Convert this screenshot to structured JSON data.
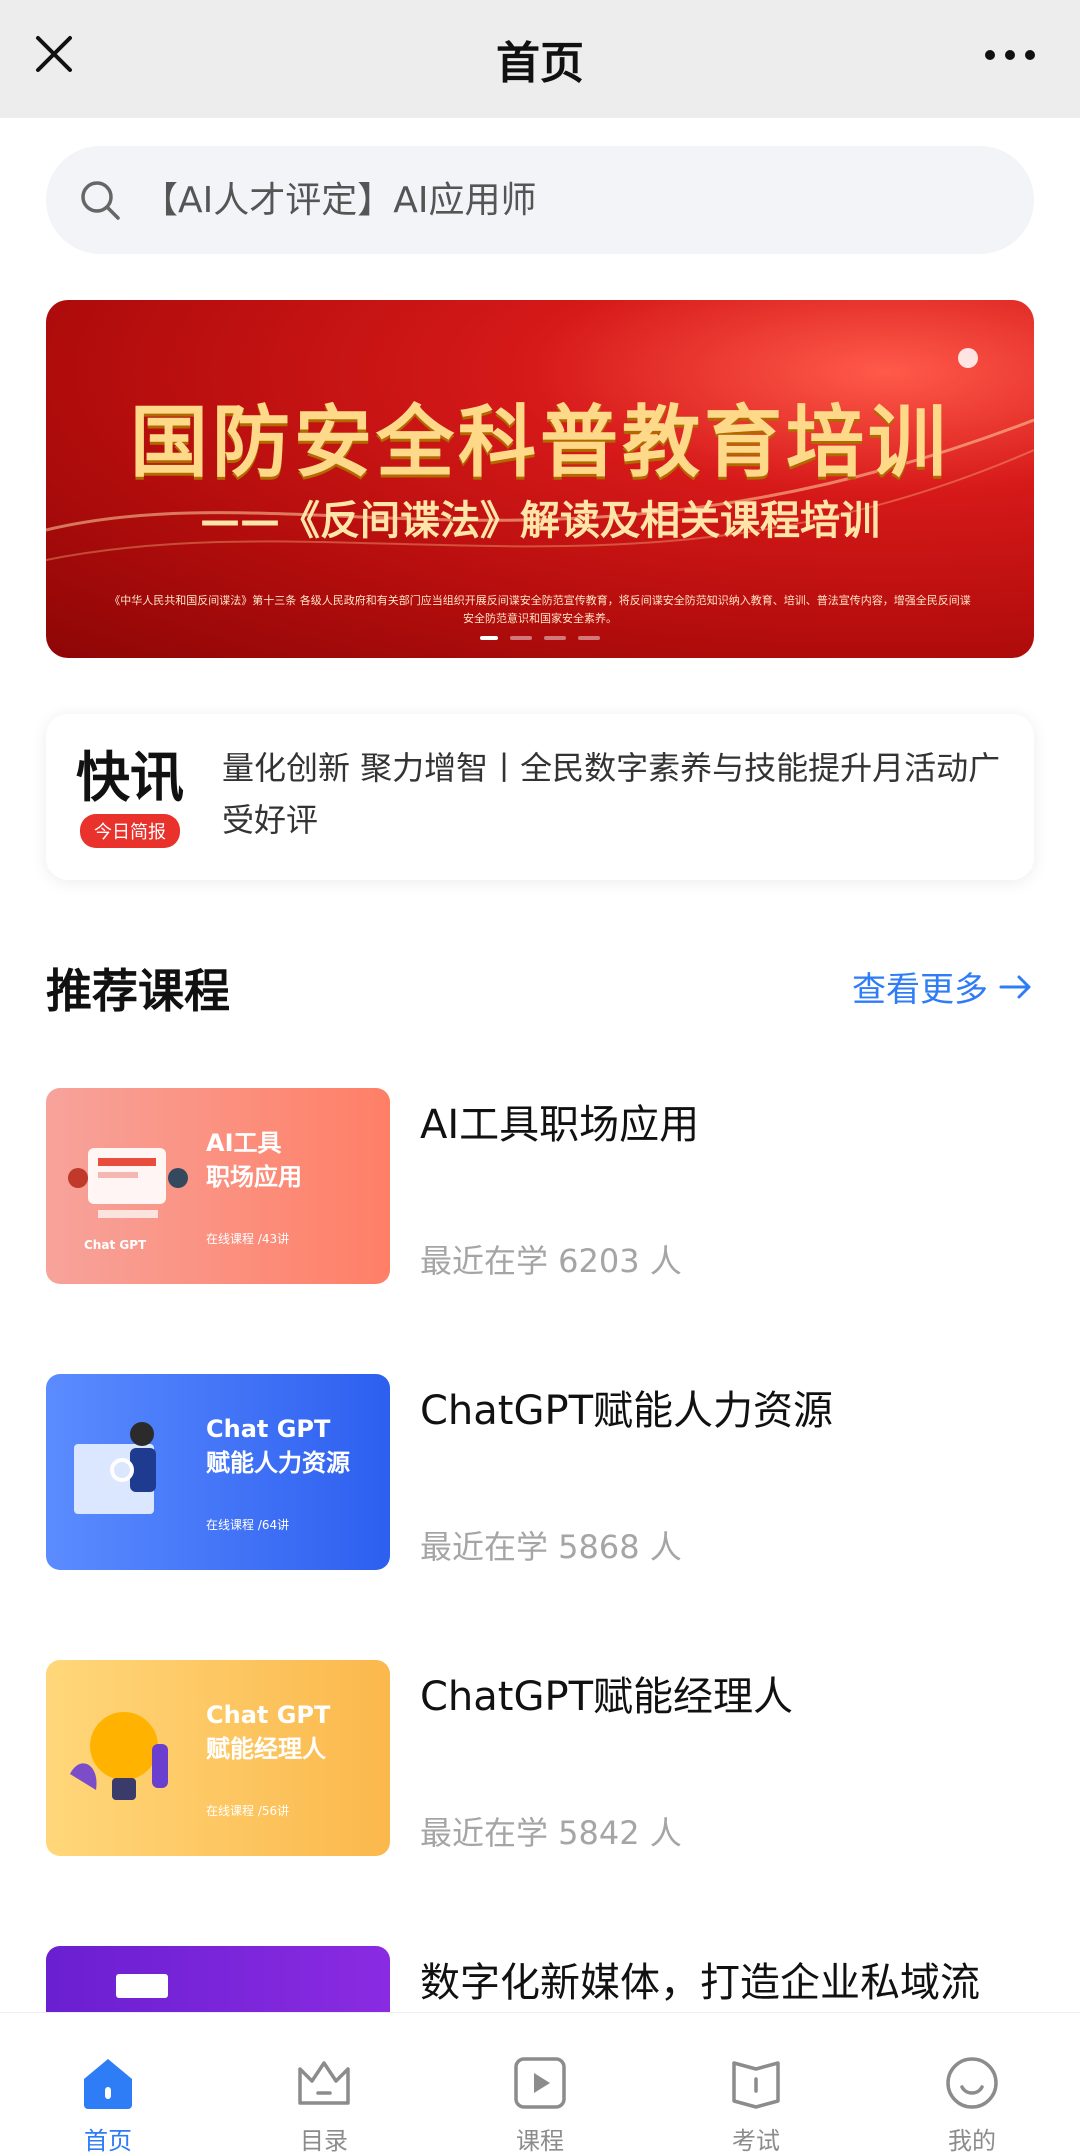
{
  "header": {
    "title": "首页"
  },
  "search": {
    "placeholder": "【AI人才评定】AI应用师"
  },
  "banner": {
    "title": "国防安全科普教育培训",
    "subtitle": "——《反间谍法》解读及相关课程培训",
    "small_text": "《中华人民共和国反间谍法》第十三条 各级人民政府和有关部门应当组织开展反间谍安全防范宣传教育，将反间谍安全防范知识纳入教育、培训、普法宣传内容，增强全民反间谍安全防范意识和国家安全素养。"
  },
  "news": {
    "brand": "快讯",
    "tag": "今日简报",
    "text": "量化创新 聚力增智丨全民数字素养与技能提升月活动广受好评"
  },
  "recommend": {
    "title": "推荐课程",
    "see_more": "查看更多"
  },
  "courses": [
    {
      "name": "AI工具职场应用",
      "thumb_title_1": "AI工具",
      "thumb_title_2": "职场应用",
      "thumb_badge": "Chat GPT",
      "thumb_lessons": "在线课程 /43讲",
      "meta": "最近在学 6203 人"
    },
    {
      "name": "ChatGPT赋能人力资源",
      "thumb_title_1": "Chat GPT",
      "thumb_title_2": "赋能人力资源",
      "thumb_lessons": "在线课程 /64讲",
      "meta": "最近在学 5868 人"
    },
    {
      "name": "ChatGPT赋能经理人",
      "thumb_title_1": "Chat GPT",
      "thumb_title_2": "赋能经理人",
      "thumb_lessons": "在线课程 /56讲",
      "meta": "最近在学 5842 人"
    },
    {
      "name": "数字化新媒体，打造企业私域流"
    }
  ],
  "tabs": [
    {
      "label": "首页",
      "icon": "home-icon",
      "active": true
    },
    {
      "label": "目录",
      "icon": "crown-icon"
    },
    {
      "label": "课程",
      "icon": "play-icon"
    },
    {
      "label": "考试",
      "icon": "exam-icon"
    },
    {
      "label": "我的",
      "icon": "smile-icon"
    }
  ],
  "colors": {
    "accent": "#2e7cf6",
    "banner_red": "#c8141a",
    "news_tag": "#e8322b"
  }
}
